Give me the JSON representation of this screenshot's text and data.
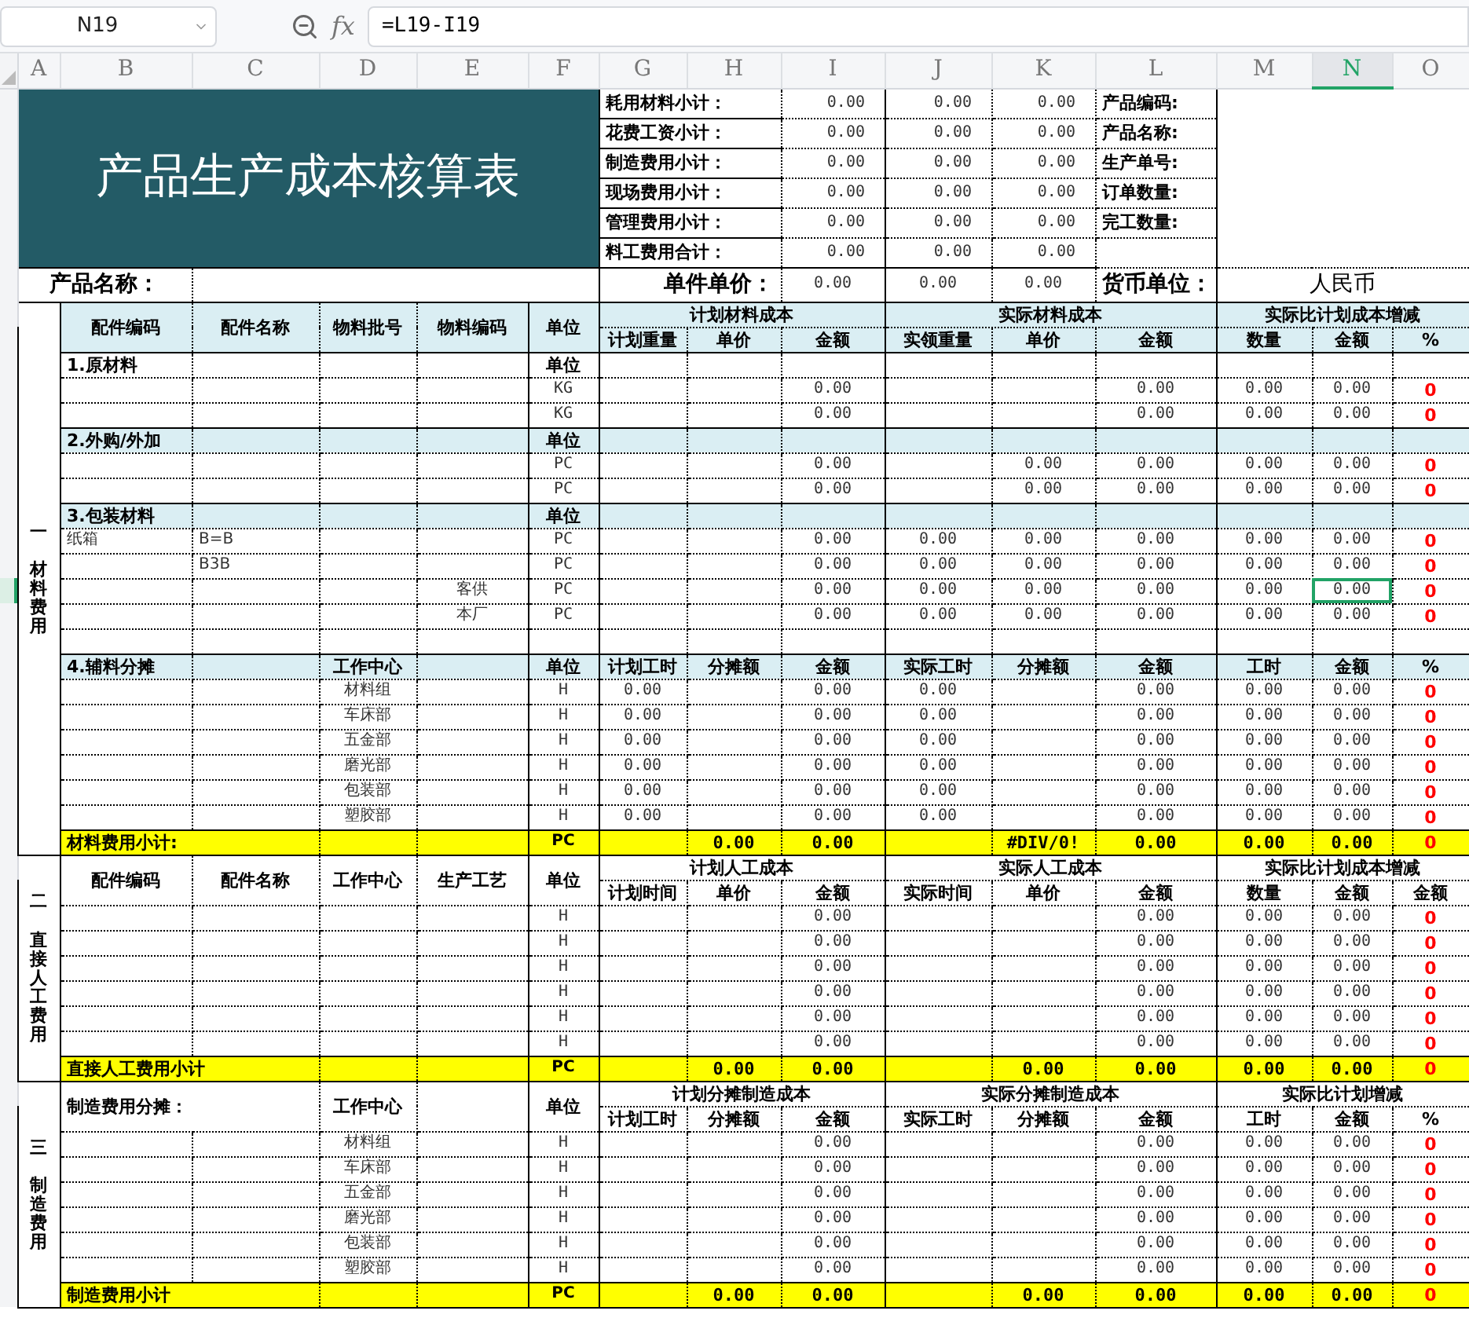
{
  "formula_bar": {
    "name_box": "N19",
    "fx": "fx",
    "formula": "=L19-I19"
  },
  "columns": [
    {
      "label": "A",
      "selected": false
    },
    {
      "label": "B",
      "selected": false
    },
    {
      "label": "C",
      "selected": false
    },
    {
      "label": "D",
      "selected": false
    },
    {
      "label": "E",
      "selected": false
    },
    {
      "label": "F",
      "selected": false
    },
    {
      "label": "G",
      "selected": false
    },
    {
      "label": "H",
      "selected": false
    },
    {
      "label": "I",
      "selected": false
    },
    {
      "label": "J",
      "selected": false
    },
    {
      "label": "K",
      "selected": false
    },
    {
      "label": "L",
      "selected": false
    },
    {
      "label": "M",
      "selected": false
    },
    {
      "label": "N",
      "selected": true
    },
    {
      "label": "O",
      "selected": false
    }
  ],
  "title": "产品生产成本核算表",
  "summary": [
    {
      "label": "耗用材料小计：",
      "values": [
        "0.00",
        "0.00",
        "0.00"
      ],
      "info_label": "产品编码:"
    },
    {
      "label": "花费工资小计：",
      "values": [
        "0.00",
        "0.00",
        "0.00"
      ],
      "info_label": "产品名称:"
    },
    {
      "label": "制造费用小计：",
      "values": [
        "0.00",
        "0.00",
        "0.00"
      ],
      "info_label": "生产单号:"
    },
    {
      "label": "现场费用小计：",
      "values": [
        "0.00",
        "0.00",
        "0.00"
      ],
      "info_label": "订单数量:"
    },
    {
      "label": "管理费用小计：",
      "values": [
        "0.00",
        "0.00",
        "0.00"
      ],
      "info_label": "完工数量:"
    },
    {
      "label": "料工费用合计：",
      "values": [
        "0.00",
        "0.00",
        "0.00"
      ]
    }
  ],
  "product_row": {
    "product_label": "产品名称：",
    "price_label": "单件单价：",
    "prices": [
      "0.00",
      "0.00",
      "0.00"
    ],
    "currency_label": "货币单位：",
    "currency": "人民币"
  },
  "sections": [
    {
      "numeral": "一",
      "label": "材料费用",
      "header": {
        "kind": "parts",
        "shaded": true,
        "fixed": {
          "B": "配件编码",
          "C": "配件名称",
          "D": "物料批号",
          "E": "物料编码",
          "F": "单位"
        },
        "groups": [
          {
            "title": "计划材料成本",
            "columns": [
              "计划重量",
              "单价",
              "金额"
            ]
          },
          {
            "title": "实际材料成本",
            "columns": [
              "实领重量",
              "单价",
              "金额"
            ]
          },
          {
            "title": "实际比计划成本增减",
            "columns": [
              "数量",
              "金额",
              "%"
            ]
          }
        ]
      },
      "rows": [
        {
          "kind": "group",
          "shaded": false,
          "selected": false,
          "B": "1.原材料",
          "F": "单位"
        },
        {
          "kind": "item",
          "selected": false,
          "F": "KG",
          "I": "0.00",
          "L": "0.00",
          "M": "0.00",
          "N": "0.00",
          "O": "0"
        },
        {
          "kind": "item",
          "selected": false,
          "F": "KG",
          "I": "0.00",
          "L": "0.00",
          "M": "0.00",
          "N": "0.00",
          "O": "0"
        },
        {
          "kind": "group",
          "shaded": true,
          "selected": false,
          "B": "2.外购/外加",
          "F": "单位"
        },
        {
          "kind": "item",
          "selected": false,
          "F": "PC",
          "I": "0.00",
          "K": "0.00",
          "L": "0.00",
          "M": "0.00",
          "N": "0.00",
          "O": "0"
        },
        {
          "kind": "item",
          "selected": false,
          "F": "PC",
          "I": "0.00",
          "K": "0.00",
          "L": "0.00",
          "M": "0.00",
          "N": "0.00",
          "O": "0"
        },
        {
          "kind": "group",
          "shaded": true,
          "selected": false,
          "B": "3.包装材料",
          "F": "单位"
        },
        {
          "kind": "item",
          "selected": false,
          "B": "纸箱",
          "C": "B=B",
          "F": "PC",
          "I": "0.00",
          "J": "0.00",
          "K": "0.00",
          "L": "0.00",
          "M": "0.00",
          "N": "0.00",
          "O": "0"
        },
        {
          "kind": "item",
          "selected": false,
          "C": "B3B",
          "F": "PC",
          "I": "0.00",
          "J": "0.00",
          "K": "0.00",
          "L": "0.00",
          "M": "0.00",
          "N": "0.00",
          "O": "0"
        },
        {
          "kind": "item",
          "selected": true,
          "E": "客供",
          "F": "PC",
          "I": "0.00",
          "J": "0.00",
          "K": "0.00",
          "L": "0.00",
          "M": "0.00",
          "N": "0.00",
          "O": "0"
        },
        {
          "kind": "item",
          "selected": false,
          "E": "本厂",
          "F": "PC",
          "I": "0.00",
          "J": "0.00",
          "K": "0.00",
          "L": "0.00",
          "M": "0.00",
          "N": "0.00",
          "O": "0"
        },
        {
          "kind": "item",
          "selected": false
        },
        {
          "kind": "group",
          "shaded": true,
          "selected": false,
          "B": "4.辅料分摊",
          "D": "工作中心",
          "F": "单位",
          "G": "计划工时",
          "H": "分摊额",
          "I": "金额",
          "J": "实际工时",
          "K": "分摊额",
          "L": "金额",
          "M": "工时",
          "N": "金额",
          "O": "%"
        },
        {
          "kind": "item",
          "selected": false,
          "D": "材料组",
          "F": "H",
          "G": "0.00",
          "I": "0.00",
          "J": "0.00",
          "L": "0.00",
          "M": "0.00",
          "N": "0.00",
          "O": "0"
        },
        {
          "kind": "item",
          "selected": false,
          "D": "车床部",
          "F": "H",
          "G": "0.00",
          "I": "0.00",
          "J": "0.00",
          "L": "0.00",
          "M": "0.00",
          "N": "0.00",
          "O": "0"
        },
        {
          "kind": "item",
          "selected": false,
          "D": "五金部",
          "F": "H",
          "G": "0.00",
          "I": "0.00",
          "J": "0.00",
          "L": "0.00",
          "M": "0.00",
          "N": "0.00",
          "O": "0"
        },
        {
          "kind": "item",
          "selected": false,
          "D": "磨光部",
          "F": "H",
          "G": "0.00",
          "I": "0.00",
          "J": "0.00",
          "L": "0.00",
          "M": "0.00",
          "N": "0.00",
          "O": "0"
        },
        {
          "kind": "item",
          "selected": false,
          "D": "包装部",
          "F": "H",
          "G": "0.00",
          "I": "0.00",
          "J": "0.00",
          "L": "0.00",
          "M": "0.00",
          "N": "0.00",
          "O": "0"
        },
        {
          "kind": "item",
          "selected": false,
          "D": "塑胶部",
          "F": "H",
          "G": "0.00",
          "I": "0.00",
          "J": "0.00",
          "L": "0.00",
          "M": "0.00",
          "N": "0.00",
          "O": "0"
        }
      ],
      "subtotal": {
        "B": "材料费用小计:",
        "F": "PC",
        "H": "0.00",
        "I": "0.00",
        "K": "#DIV/0!",
        "L": "0.00",
        "M": "0.00",
        "N": "0.00",
        "O": "0"
      }
    },
    {
      "numeral": "二",
      "label": "直接人工费用",
      "header": {
        "kind": "parts",
        "shaded": false,
        "fixed": {
          "B": "配件编码",
          "C": "配件名称",
          "D": "工作中心",
          "E": "生产工艺",
          "F": "单位"
        },
        "groups": [
          {
            "title": "计划人工成本",
            "columns": [
              "计划时间",
              "单价",
              "金额"
            ]
          },
          {
            "title": "实际人工成本",
            "columns": [
              "实际时间",
              "单价",
              "金额"
            ]
          },
          {
            "title": "实际比计划成本增减",
            "columns": [
              "数量",
              "金额",
              "金额"
            ]
          }
        ]
      },
      "rows": [
        {
          "kind": "item",
          "selected": false,
          "F": "H",
          "I": "0.00",
          "L": "0.00",
          "M": "0.00",
          "N": "0.00",
          "O": "0"
        },
        {
          "kind": "item",
          "selected": false,
          "F": "H",
          "I": "0.00",
          "L": "0.00",
          "M": "0.00",
          "N": "0.00",
          "O": "0"
        },
        {
          "kind": "item",
          "selected": false,
          "F": "H",
          "I": "0.00",
          "L": "0.00",
          "M": "0.00",
          "N": "0.00",
          "O": "0"
        },
        {
          "kind": "item",
          "selected": false,
          "F": "H",
          "I": "0.00",
          "L": "0.00",
          "M": "0.00",
          "N": "0.00",
          "O": "0"
        },
        {
          "kind": "item",
          "selected": false,
          "F": "H",
          "I": "0.00",
          "L": "0.00",
          "M": "0.00",
          "N": "0.00",
          "O": "0"
        },
        {
          "kind": "item",
          "selected": false,
          "F": "H",
          "I": "0.00",
          "L": "0.00",
          "M": "0.00",
          "N": "0.00",
          "O": "0"
        }
      ],
      "subtotal": {
        "B": "直接人工费用小计",
        "F": "PC",
        "H": "0.00",
        "I": "0.00",
        "K": "0.00",
        "L": "0.00",
        "M": "0.00",
        "N": "0.00",
        "O": "0"
      }
    },
    {
      "numeral": "三",
      "label": "制造费用",
      "header": {
        "kind": "allocation",
        "shaded": false,
        "fixed": {
          "B": "制造费用分摊：",
          "D": "工作中心",
          "F": "单位"
        },
        "groups": [
          {
            "title": "计划分摊制造成本",
            "columns": [
              "计划工时",
              "分摊额",
              "金额"
            ]
          },
          {
            "title": "实际分摊制造成本",
            "columns": [
              "实际工时",
              "分摊额",
              "金额"
            ]
          },
          {
            "title": "实际比计划增减",
            "columns": [
              "工时",
              "金额",
              "%"
            ]
          }
        ]
      },
      "rows": [
        {
          "kind": "item",
          "selected": false,
          "D": "材料组",
          "F": "H",
          "I": "0.00",
          "L": "0.00",
          "M": "0.00",
          "N": "0.00",
          "O": "0"
        },
        {
          "kind": "item",
          "selected": false,
          "D": "车床部",
          "F": "H",
          "I": "0.00",
          "L": "0.00",
          "M": "0.00",
          "N": "0.00",
          "O": "0"
        },
        {
          "kind": "item",
          "selected": false,
          "D": "五金部",
          "F": "H",
          "I": "0.00",
          "L": "0.00",
          "M": "0.00",
          "N": "0.00",
          "O": "0"
        },
        {
          "kind": "item",
          "selected": false,
          "D": "磨光部",
          "F": "H",
          "I": "0.00",
          "L": "0.00",
          "M": "0.00",
          "N": "0.00",
          "O": "0"
        },
        {
          "kind": "item",
          "selected": false,
          "D": "包装部",
          "F": "H",
          "I": "0.00",
          "L": "0.00",
          "M": "0.00",
          "N": "0.00",
          "O": "0"
        },
        {
          "kind": "item",
          "selected": false,
          "D": "塑胶部",
          "F": "H",
          "I": "0.00",
          "L": "0.00",
          "M": "0.00",
          "N": "0.00",
          "O": "0"
        }
      ],
      "subtotal": {
        "B": "制造费用小计",
        "F": "PC",
        "H": "0.00",
        "I": "0.00",
        "K": "0.00",
        "L": "0.00",
        "M": "0.00",
        "N": "0.00",
        "O": "0"
      }
    }
  ]
}
